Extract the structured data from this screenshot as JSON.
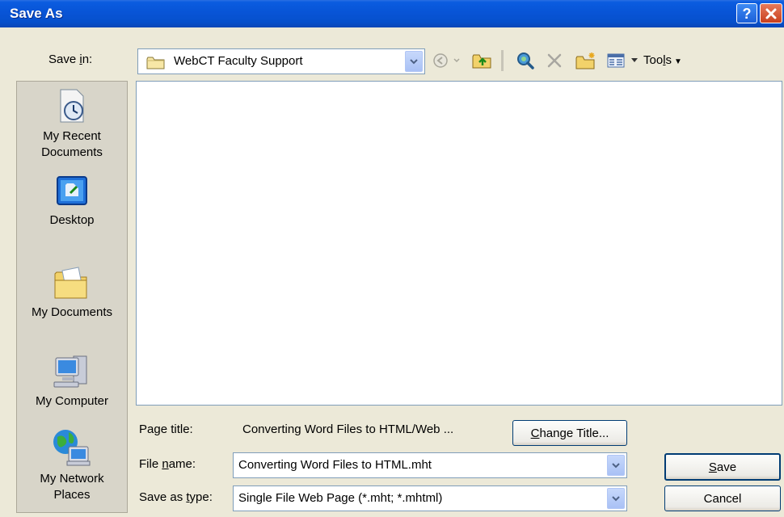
{
  "window": {
    "title": "Save As"
  },
  "save_in": {
    "label": "Save in:",
    "label_underline": "i",
    "value": "WebCT Faculty Support"
  },
  "toolbar": {
    "icons": [
      "back-icon",
      "up-folder-icon",
      "search-web-icon",
      "delete-icon",
      "new-folder-icon",
      "views-icon"
    ],
    "tools_label": "Tools",
    "tools_underline": "l"
  },
  "places": [
    {
      "label1": "My Recent",
      "label2": "Documents",
      "icon": "recent-documents-icon"
    },
    {
      "label1": "Desktop",
      "label2": "",
      "icon": "desktop-icon"
    },
    {
      "label1": "My Documents",
      "label2": "",
      "icon": "my-documents-icon"
    },
    {
      "label1": "My Computer",
      "label2": "",
      "icon": "my-computer-icon"
    },
    {
      "label1": "My Network",
      "label2": "Places",
      "icon": "my-network-places-icon"
    }
  ],
  "page_title": {
    "label": "Page title:",
    "value": "Converting Word Files to HTML/Web ..."
  },
  "change_title_button": "Change Title...",
  "file_name": {
    "label": "File name:",
    "value": "Converting Word Files to HTML.mht"
  },
  "save_as_type": {
    "label": "Save as type:",
    "value": "Single File Web Page (*.mht; *.mhtml)"
  },
  "buttons": {
    "save": "Save",
    "cancel": "Cancel"
  },
  "colors": {
    "titlebar": "#0854d6",
    "dialog_bg": "#ece9d8",
    "places_bg": "#d8d5c9",
    "field_border": "#7f9db9"
  }
}
